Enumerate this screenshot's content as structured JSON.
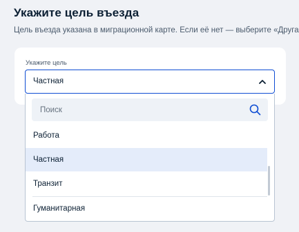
{
  "page": {
    "title": "Укажите цель въезда",
    "subtitle": "Цель въезда указана в миграционной карте. Если её нет — выберите «Другая»"
  },
  "form": {
    "field_label": "Укажите цель",
    "selected_value": "Частная"
  },
  "dropdown": {
    "search_placeholder": "Поиск",
    "options": [
      {
        "label": "Работа",
        "selected": false
      },
      {
        "label": "Частная",
        "selected": true
      },
      {
        "label": "Транзит",
        "selected": false
      },
      {
        "label": "Гуманитарная",
        "selected": false
      }
    ]
  },
  "colors": {
    "accent": "#0d4cd3",
    "background": "#f0f2f6",
    "selected_option_bg": "#e4ecfa"
  },
  "icons": {
    "chevron": "chevron-up-icon",
    "search": "search-icon"
  }
}
